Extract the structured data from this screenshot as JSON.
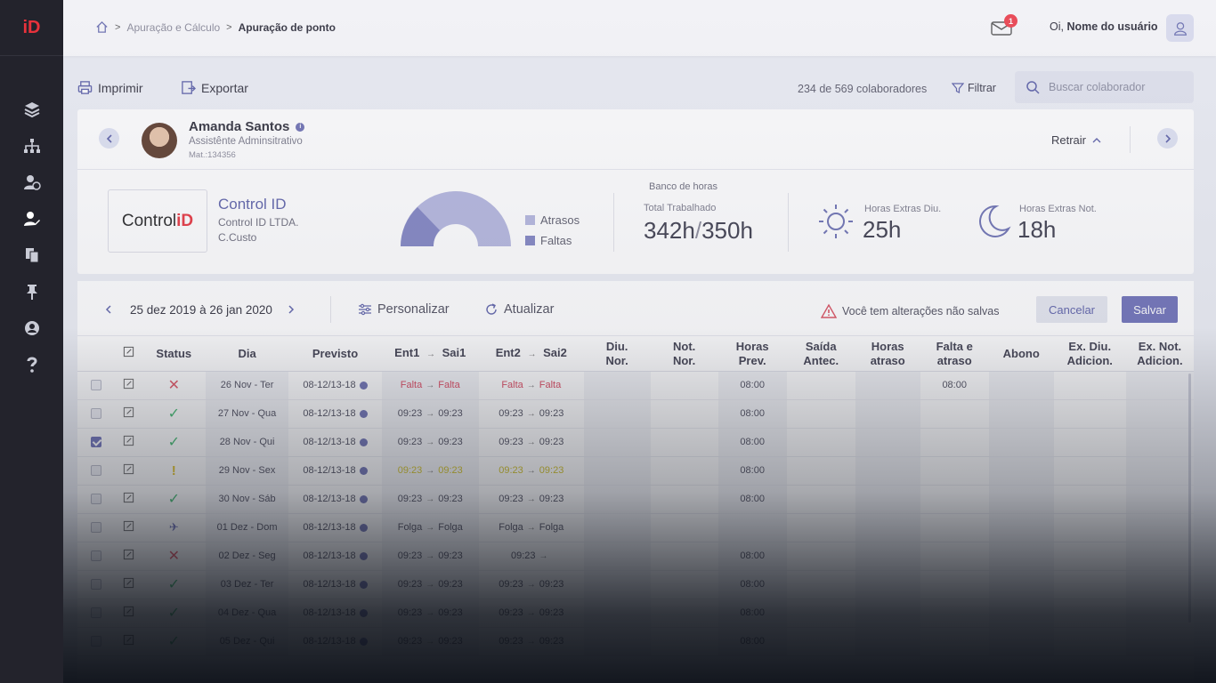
{
  "app": {
    "logo": "iD"
  },
  "breadcrumb": {
    "parent": "Apuração e Cálculo",
    "current": "Apuração de ponto"
  },
  "header": {
    "notifications": "1",
    "greeting": "Oi, ",
    "user_name": "Nome do usuário"
  },
  "toolbar": {
    "print_label": "Imprimir",
    "export_label": "Exportar",
    "count": "234 de 569 colaboradores",
    "filter_label": "Filtrar",
    "search_placeholder": "Buscar colaborador"
  },
  "employee": {
    "name": "Amanda Santos",
    "role": "Assistênte Adminsitrativo",
    "mat": "Mat.:134356",
    "collapse_label": "Retrair"
  },
  "company": {
    "logo_text": "Control ",
    "logo_id": "iD",
    "name": "Control ID",
    "legal": "Control ID LTDA.",
    "cost_center": "C.Custo"
  },
  "chart_data": {
    "type": "pie",
    "legend": [
      "Atrasos",
      "Faltas"
    ],
    "colors": {
      "atrasos": "#b3b5de",
      "faltas": "#7f82c2"
    }
  },
  "bank": {
    "title": "Banco de horas",
    "total_label": "Total Trabalhado",
    "worked": "342h",
    "expected": "350h",
    "day_extra_label": "Horas Extras Diu.",
    "day_extra": "25h",
    "night_extra_label": "Horas Extras Not.",
    "night_extra": "18h"
  },
  "period": {
    "label": "25 dez 2019 à 26 jan 2020",
    "customize_label": "Personalizar",
    "refresh_label": "Atualizar",
    "warning": "Você tem alterações não salvas",
    "cancel_label": "Cancelar",
    "save_label": "Salvar"
  },
  "columns": {
    "status": "Status",
    "dia": "Dia",
    "previsto": "Previsto",
    "ent1": "Ent1",
    "sai1": "Sai1",
    "ent2": "Ent2",
    "sai2": "Sai2",
    "diu_nor_1": "Diu.",
    "diu_nor_2": "Nor.",
    "not_nor_1": "Not.",
    "not_nor_2": "Nor.",
    "horas_prev_1": "Horas",
    "horas_prev_2": "Prev.",
    "saida_antec_1": "Saída",
    "saida_antec_2": "Antec.",
    "horas_atraso_1": "Horas",
    "horas_atraso_2": "atraso",
    "falta_atraso_1": "Falta e",
    "falta_atraso_2": "atraso",
    "abono": "Abono",
    "ex_diu_1": "Ex. Diu.",
    "ex_diu_2": "Adicion.",
    "ex_not_1": "Ex. Not.",
    "ex_not_2": "Adicion."
  },
  "rows": [
    {
      "checked": false,
      "status": "x",
      "dia": "26 Nov - Ter",
      "previsto": "08-12/13-18",
      "ent1": "Falta",
      "sai1": "Falta",
      "ent2": "Falta",
      "sai2": "Falta",
      "tone": "red",
      "horas_prev": "08:00",
      "falta_atraso": "08:00"
    },
    {
      "checked": false,
      "status": "ok",
      "dia": "27 Nov - Qua",
      "previsto": "08-12/13-18",
      "ent1": "09:23",
      "sai1": "09:23",
      "ent2": "09:23",
      "sai2": "09:23",
      "tone": "",
      "horas_prev": "08:00",
      "falta_atraso": ""
    },
    {
      "checked": true,
      "status": "ok",
      "dia": "28 Nov - Qui",
      "previsto": "08-12/13-18",
      "ent1": "09:23",
      "sai1": "09:23",
      "ent2": "09:23",
      "sai2": "09:23",
      "tone": "",
      "horas_prev": "08:00",
      "falta_atraso": ""
    },
    {
      "checked": false,
      "status": "ex",
      "dia": "29 Nov - Sex",
      "previsto": "08-12/13-18",
      "ent1": "09:23",
      "sai1": "09:23",
      "ent2": "09:23",
      "sai2": "09:23",
      "tone": "yel",
      "horas_prev": "08:00",
      "falta_atraso": ""
    },
    {
      "checked": false,
      "status": "ok",
      "dia": "30 Nov - Sáb",
      "previsto": "08-12/13-18",
      "ent1": "09:23",
      "sai1": "09:23",
      "ent2": "09:23",
      "sai2": "09:23",
      "tone": "",
      "horas_prev": "08:00",
      "falta_atraso": ""
    },
    {
      "checked": false,
      "status": "plane",
      "dia": "01 Dez - Dom",
      "previsto": "08-12/13-18",
      "ent1": "Folga",
      "sai1": "Folga",
      "ent2": "Folga",
      "sai2": "Folga",
      "tone": "",
      "horas_prev": "",
      "falta_atraso": ""
    },
    {
      "checked": false,
      "status": "x",
      "dia": "02 Dez - Seg",
      "previsto": "08-12/13-18",
      "ent1": "09:23",
      "sai1": "09:23",
      "ent2": "09:23",
      "sai2": "",
      "tone": "",
      "horas_prev": "08:00",
      "falta_atraso": ""
    },
    {
      "checked": false,
      "status": "ok",
      "dia": "03 Dez - Ter",
      "previsto": "08-12/13-18",
      "ent1": "09:23",
      "sai1": "09:23",
      "ent2": "09:23",
      "sai2": "09:23",
      "tone": "",
      "horas_prev": "08:00",
      "falta_atraso": ""
    },
    {
      "checked": false,
      "status": "ok",
      "dia": "04 Dez - Qua",
      "previsto": "08-12/13-18",
      "ent1": "09:23",
      "sai1": "09:23",
      "ent2": "09:23",
      "sai2": "09:23",
      "tone": "",
      "horas_prev": "08:00",
      "falta_atraso": ""
    },
    {
      "checked": false,
      "status": "ok",
      "dia": "05 Dez - Qui",
      "previsto": "08-12/13-18",
      "ent1": "09:23",
      "sai1": "09:23",
      "ent2": "09:23",
      "sai2": "09:23",
      "tone": "",
      "horas_prev": "08:00",
      "falta_atraso": ""
    }
  ]
}
